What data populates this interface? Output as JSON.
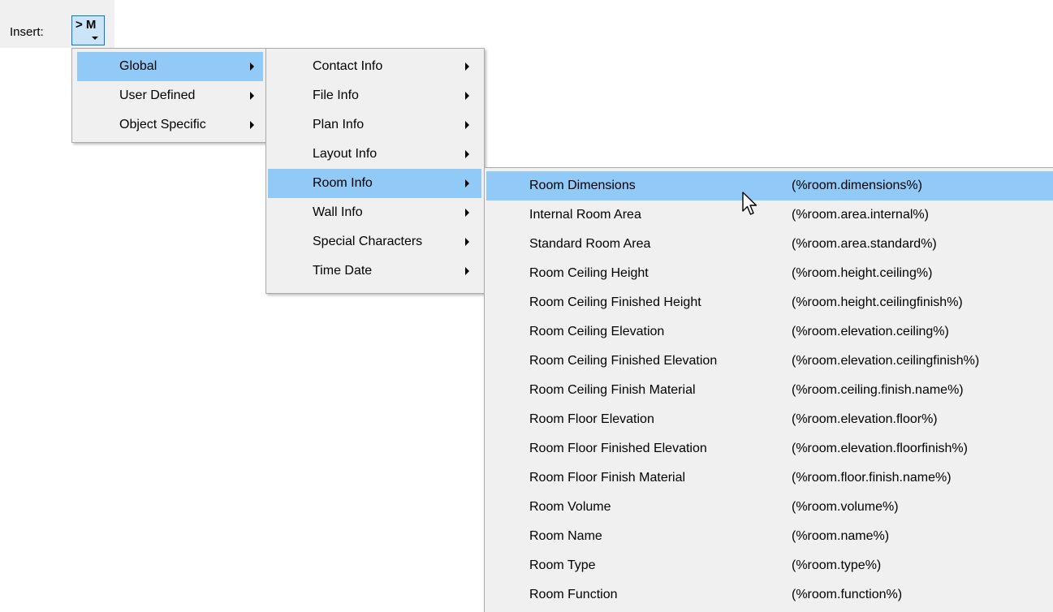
{
  "insert_bar": {
    "label": "Insert:",
    "button_label": "> M"
  },
  "menu_level1": {
    "items": [
      {
        "label": "Global",
        "highlighted": true
      },
      {
        "label": "User Defined",
        "highlighted": false
      },
      {
        "label": "Object Specific",
        "highlighted": false
      }
    ]
  },
  "menu_level2": {
    "items": [
      {
        "label": "Contact Info",
        "highlighted": false
      },
      {
        "label": "File Info",
        "highlighted": false
      },
      {
        "label": "Plan Info",
        "highlighted": false
      },
      {
        "label": "Layout Info",
        "highlighted": false
      },
      {
        "label": "Room Info",
        "highlighted": true
      },
      {
        "label": "Wall Info",
        "highlighted": false
      },
      {
        "label": "Special Characters",
        "highlighted": false
      },
      {
        "label": "Time  Date",
        "highlighted": false
      }
    ]
  },
  "menu_level3": {
    "items": [
      {
        "label": "Room Dimensions",
        "macro": "(%room.dimensions%)",
        "highlighted": true
      },
      {
        "label": "Internal Room Area",
        "macro": "(%room.area.internal%)",
        "highlighted": false
      },
      {
        "label": "Standard Room Area",
        "macro": "(%room.area.standard%)",
        "highlighted": false
      },
      {
        "label": "Room Ceiling Height",
        "macro": "(%room.height.ceiling%)",
        "highlighted": false
      },
      {
        "label": "Room Ceiling Finished Height",
        "macro": "(%room.height.ceilingfinish%)",
        "highlighted": false
      },
      {
        "label": "Room Ceiling Elevation",
        "macro": "(%room.elevation.ceiling%)",
        "highlighted": false
      },
      {
        "label": "Room Ceiling Finished Elevation",
        "macro": "(%room.elevation.ceilingfinish%)",
        "highlighted": false
      },
      {
        "label": "Room Ceiling Finish Material",
        "macro": "(%room.ceiling.finish.name%)",
        "highlighted": false
      },
      {
        "label": "Room Floor Elevation",
        "macro": "(%room.elevation.floor%)",
        "highlighted": false
      },
      {
        "label": "Room Floor Finished Elevation",
        "macro": "(%room.elevation.floorfinish%)",
        "highlighted": false
      },
      {
        "label": "Room Floor Finish Material",
        "macro": "(%room.floor.finish.name%)",
        "highlighted": false
      },
      {
        "label": "Room Volume",
        "macro": "(%room.volume%)",
        "highlighted": false
      },
      {
        "label": "Room Name",
        "macro": "(%room.name%)",
        "highlighted": false
      },
      {
        "label": "Room Type",
        "macro": "(%room.type%)",
        "highlighted": false
      },
      {
        "label": "Room Function",
        "macro": "(%room.function%)",
        "highlighted": false
      }
    ]
  },
  "cursor_icon": "mouse-pointer-icon"
}
